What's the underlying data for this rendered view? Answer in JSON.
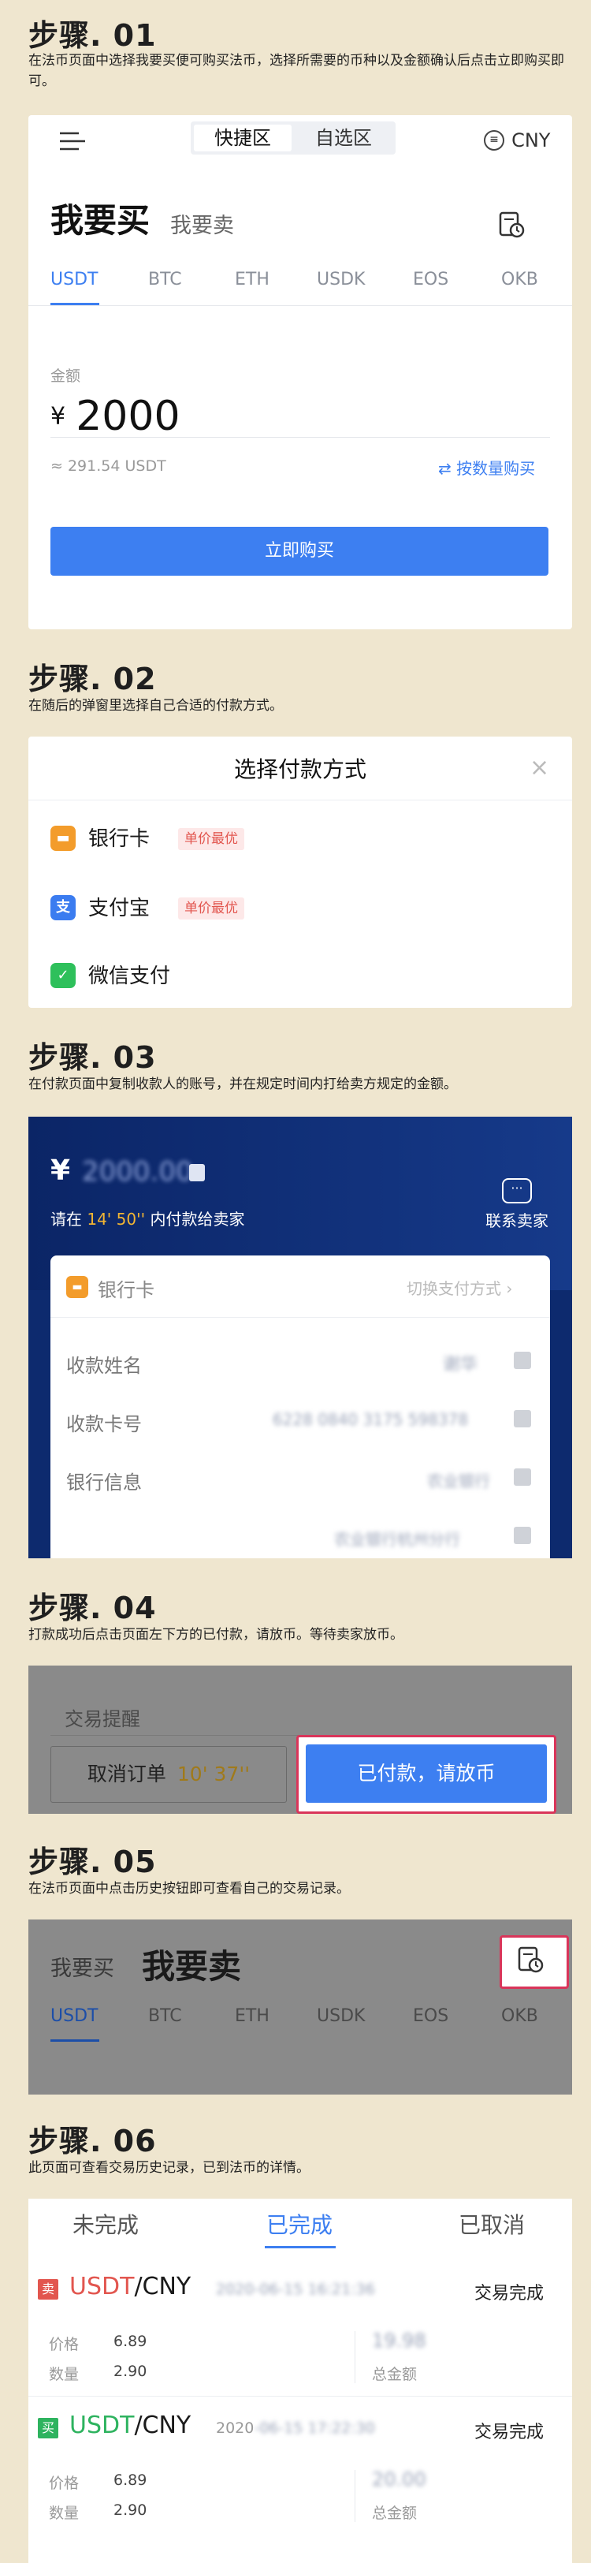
{
  "steps": [
    {
      "title": "步骤. 01",
      "desc": "在法币页面中选择我要买便可购买法币，选择所需要的币种以及金额确认后点击立即购买即可。"
    },
    {
      "title": "步骤. 02",
      "desc": "在随后的弹窗里选择自己合适的付款方式。"
    },
    {
      "title": "步骤. 03",
      "desc": "在付款页面中复制收款人的账号，并在规定时间内打给卖方规定的金额。"
    },
    {
      "title": "步骤. 04",
      "desc": "打款成功后点击页面左下方的已付款，请放币。等待卖家放币。"
    },
    {
      "title": "步骤. 05",
      "desc": "在法币页面中点击历史按钮即可查看自己的交易记录。"
    },
    {
      "title": "步骤. 06",
      "desc": "此页面可查看交易历史记录，已到法币的详情。"
    }
  ],
  "s1": {
    "tab_fast": "快捷区",
    "tab_self": "自选区",
    "currency": "CNY",
    "buy": "我要买",
    "sell": "我要卖",
    "coins": [
      "USDT",
      "BTC",
      "ETH",
      "USDK",
      "EOS",
      "OKB"
    ],
    "amount_label": "金额",
    "currency_symbol": "¥",
    "amount": "2000",
    "approx": "≈ 291.54 USDT",
    "by_qty": "按数量购买",
    "buy_now": "立即购买"
  },
  "s2": {
    "title": "选择付款方式",
    "methods": [
      {
        "label": "银行卡",
        "tag": "单价最优",
        "icon_color": "#f39c2b"
      },
      {
        "label": "支付宝",
        "tag": "单价最优",
        "icon_color": "#3b7cf0"
      },
      {
        "label": "微信支付",
        "tag": "",
        "icon_color": "#2ec05b"
      }
    ]
  },
  "s3": {
    "yen": "¥",
    "amount_hidden": "2000.00",
    "pay_prefix": "请在",
    "pay_time": "14' 50''",
    "pay_suffix": "内付款给卖家",
    "contact": "联系卖家",
    "method": "银行卡",
    "switch": "切换支付方式",
    "payee_label": "收款姓名",
    "payee": "谢华",
    "card_label": "收款卡号",
    "card": "6228 0840 3175 598378",
    "bank_label": "银行信息",
    "bank": "农业银行",
    "branch": "农业银行杭州分行"
  },
  "s4": {
    "reminder": "交易提醒",
    "cancel": "取消订单",
    "cancel_time": "10' 37''",
    "paid": "已付款，请放币"
  },
  "s5": {
    "buy": "我要买",
    "sell": "我要卖",
    "coins": [
      "USDT",
      "BTC",
      "ETH",
      "USDK",
      "EOS",
      "OKB"
    ]
  },
  "s6": {
    "tabs": [
      "未完成",
      "已完成",
      "已取消"
    ],
    "orders": [
      {
        "side": "卖",
        "side_color": "#e2564f",
        "coin": "USDT",
        "fiat": "/CNY",
        "date": "2020-06-15 16:21:36",
        "status": "交易完成",
        "price_label": "价格",
        "price": "6.89",
        "qty_label": "数量",
        "qty": "2.90",
        "total": "19.98",
        "total_label": "总金额"
      },
      {
        "side": "买",
        "side_color": "#2eb35f",
        "coin": "USDT",
        "fiat": "/CNY",
        "date": "2020",
        "date_blur": "-06-15 17:22:30",
        "status": "交易完成",
        "price_label": "价格",
        "price": "6.89",
        "qty_label": "数量",
        "qty": "2.90",
        "total": "20.00",
        "total_label": "总金额"
      }
    ]
  }
}
